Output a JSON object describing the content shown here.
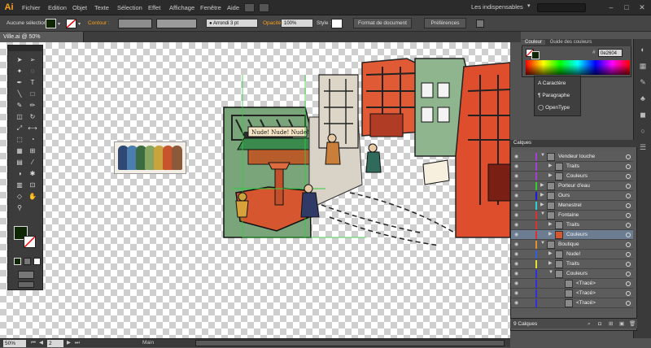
{
  "app": {
    "logo": "Ai"
  },
  "menu": [
    "Fichier",
    "Edition",
    "Objet",
    "Texte",
    "Sélection",
    "Effet",
    "Affichage",
    "Fenêtre",
    "Aide"
  ],
  "workspace": "Les indispensables",
  "controlbar": {
    "selection": "Aucune sélection",
    "contour_label": "Contour :",
    "stroke_style": "Arrondi 3 pt",
    "opacity_label": "Opacité",
    "opacity_value": "100%",
    "style_label": "Style :",
    "doc_format": "Format de document",
    "preferences": "Préférences"
  },
  "document": {
    "tab": "Ville.ai @ 50% (RVB/Aperçu)"
  },
  "status": {
    "zoom": "50%",
    "page": "2",
    "artboard": "Main"
  },
  "color_panel": {
    "tab1": "Couleur",
    "tab2": "Guide des couleurs",
    "hex": "0e2604"
  },
  "char_panel": {
    "items": [
      "Caractère",
      "Paragraphe",
      "OpenType"
    ]
  },
  "layers_panel": {
    "tab": "Calques",
    "footer": "9 Calques",
    "rows": [
      {
        "name": "Vendeur louche",
        "color": "#a33fd6"
      },
      {
        "name": "Traits",
        "color": "#a33fd6"
      },
      {
        "name": "Couleurs",
        "color": "#a33fd6"
      },
      {
        "name": "Porteur d'eau",
        "color": "#2fcf2f"
      },
      {
        "name": "Ours",
        "color": "#1a1adf"
      },
      {
        "name": "Menestrel",
        "color": "#2fcfcf"
      },
      {
        "name": "Fontaine",
        "color": "#df2f2f"
      },
      {
        "name": "Traits",
        "color": "#df2f2f"
      },
      {
        "name": "Couleurs",
        "color": "#df2f2f"
      },
      {
        "name": "Boutique",
        "color": "#df8f2f"
      },
      {
        "name": "Nude!",
        "color": "#2f5fdf"
      },
      {
        "name": "Traits",
        "color": "#e0e02f"
      },
      {
        "name": "Couleurs",
        "color": "#2f2fdf"
      },
      {
        "name": "<Tracé>",
        "color": "#2f2fdf"
      },
      {
        "name": "<Tracé>",
        "color": "#2f2fdf"
      },
      {
        "name": "<Tracé>",
        "color": "#2f2fdf"
      }
    ]
  },
  "palette_swatches": [
    "#2e4a74",
    "#4a7db0",
    "#3b6b40",
    "#86a561",
    "#c9a43c",
    "#c7542d",
    "#8b5a3a",
    "#d8a87a"
  ],
  "colors": {
    "fill": "#0e2604",
    "accent_orange": "#e8731f"
  }
}
